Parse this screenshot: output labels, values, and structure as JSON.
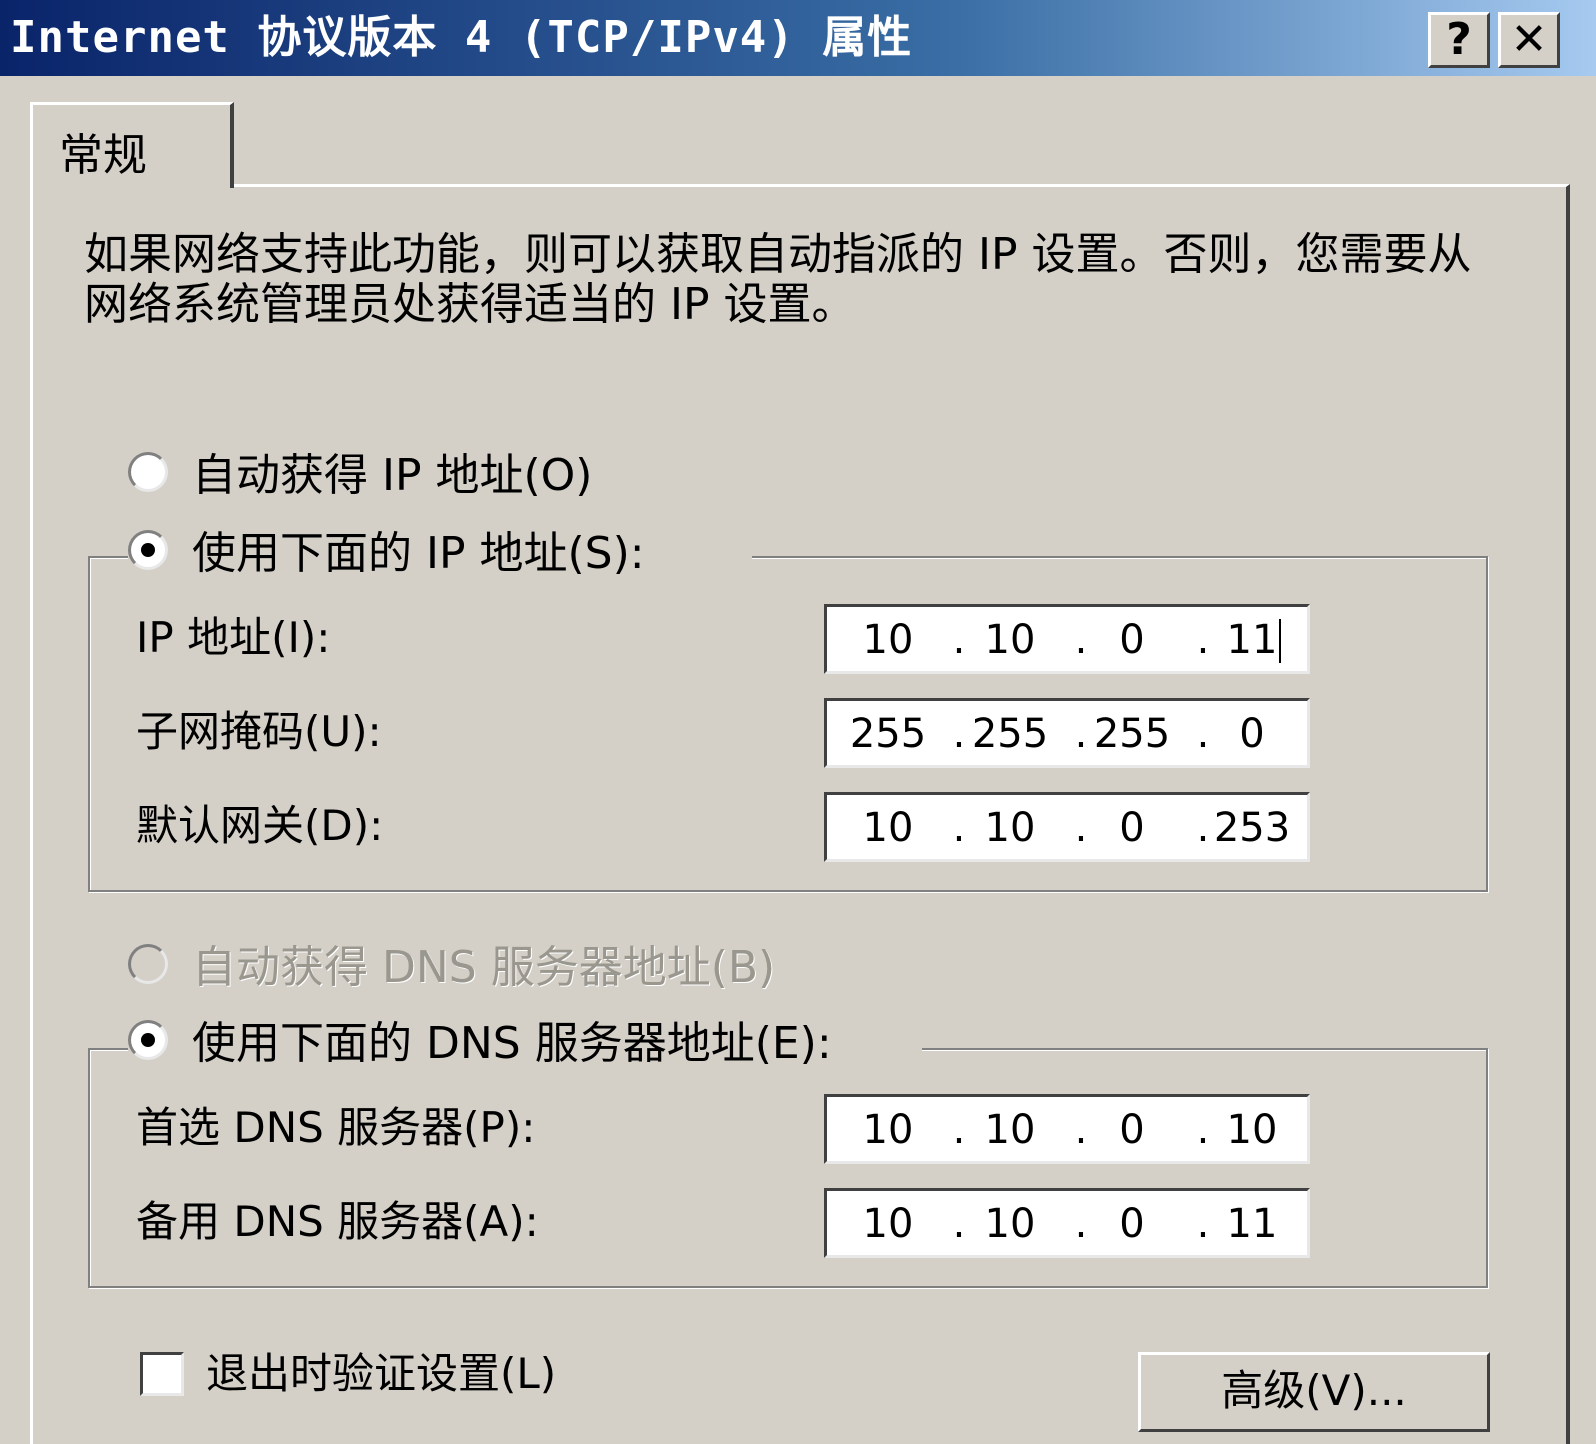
{
  "window": {
    "title": "Internet 协议版本 4 (TCP/IPv4) 属性",
    "help_label": "?",
    "close_label": "✕"
  },
  "tab": {
    "label": "常规"
  },
  "description": "如果网络支持此功能，则可以获取自动指派的 IP 设置。否则，您需要从网络系统管理员处获得适当的 IP 设置。",
  "ip_section": {
    "auto_label": "自动获得 IP 地址(O)",
    "auto_selected": false,
    "manual_label": "使用下面的 IP 地址(S):",
    "manual_selected": true,
    "ip_label": "IP 地址(I):",
    "ip": [
      "10",
      "10",
      "0",
      "11"
    ],
    "subnet_label": "子网掩码(U):",
    "subnet": [
      "255",
      "255",
      "255",
      "0"
    ],
    "gateway_label": "默认网关(D):",
    "gateway": [
      "10",
      "10",
      "0",
      "253"
    ]
  },
  "dns_section": {
    "auto_label": "自动获得 DNS 服务器地址(B)",
    "auto_selected": false,
    "auto_disabled": true,
    "manual_label": "使用下面的 DNS 服务器地址(E):",
    "manual_selected": true,
    "preferred_label": "首选 DNS 服务器(P):",
    "preferred": [
      "10",
      "10",
      "0",
      "10"
    ],
    "alternate_label": "备用 DNS 服务器(A):",
    "alternate": [
      "10",
      "10",
      "0",
      "11"
    ]
  },
  "footer": {
    "validate_label": "退出时验证设置(L)",
    "validate_checked": false,
    "advanced_label": "高级(V)..."
  },
  "separator": "."
}
